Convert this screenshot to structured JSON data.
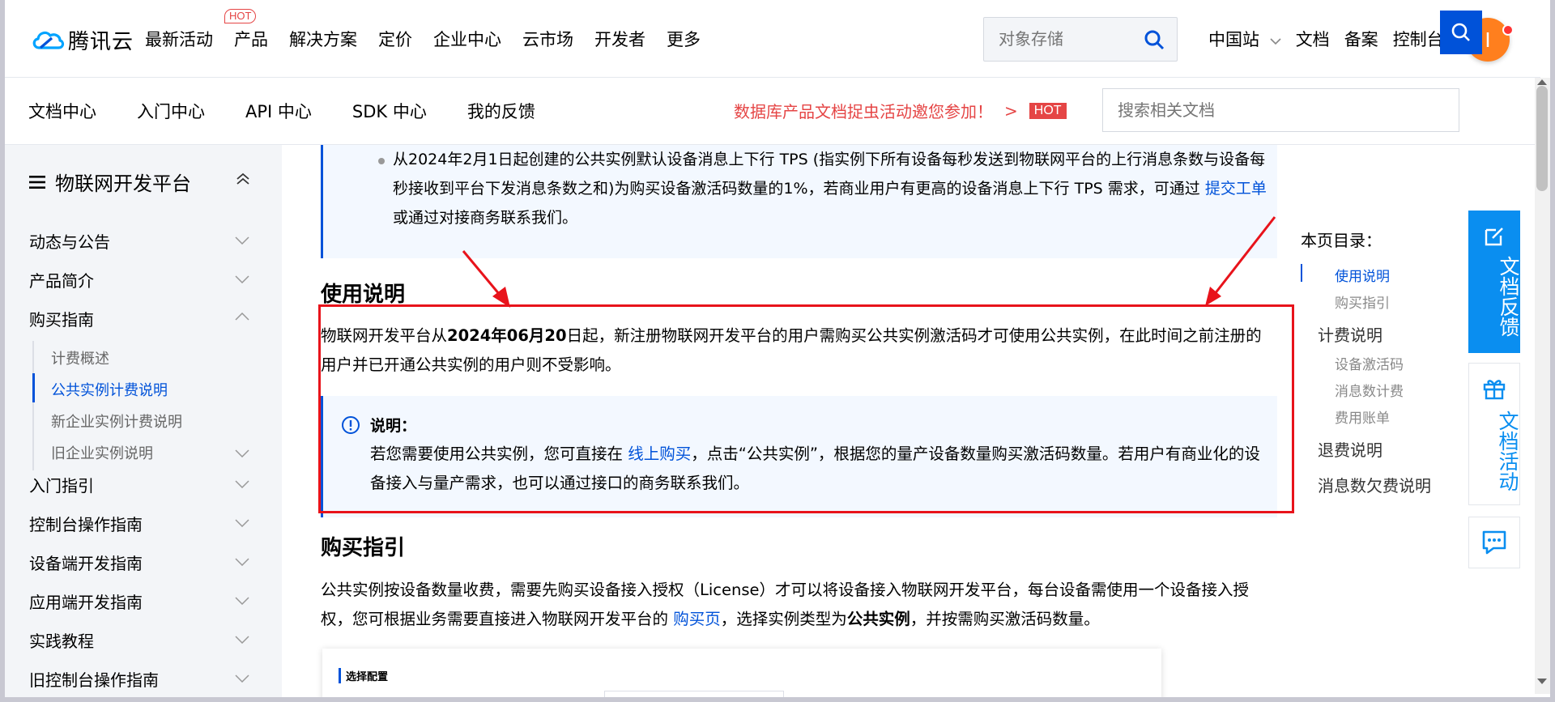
{
  "topnav": {
    "logo_text": "腾讯云",
    "items": [
      "最新活动",
      "产品",
      "解决方案",
      "定价",
      "企业中心",
      "云市场",
      "开发者",
      "更多"
    ],
    "hot_badge": "HOT",
    "search_placeholder": "对象存储",
    "right_links": [
      "中国站",
      "文档",
      "备案",
      "控制台"
    ],
    "avatar_initial": "I"
  },
  "subnav": {
    "items": [
      "文档中心",
      "入门中心",
      "API 中心",
      "SDK 中心",
      "我的反馈"
    ],
    "promo_text": "数据库产品文档捉虫活动邀您参加！",
    "promo_arrow": ">",
    "promo_hot": "HOT",
    "doc_search_placeholder": "搜索相关文档"
  },
  "sidebar": {
    "title": "物联网开发平台",
    "items": [
      {
        "label": "动态与公告"
      },
      {
        "label": "产品简介"
      },
      {
        "label": "购买指南"
      },
      {
        "label": "入门指引"
      },
      {
        "label": "控制台操作指南"
      },
      {
        "label": "设备端开发指南"
      },
      {
        "label": "应用端开发指南"
      },
      {
        "label": "实践教程"
      },
      {
        "label": "旧控制台操作指南"
      }
    ],
    "sub_items": [
      {
        "label": "计费概述"
      },
      {
        "label": "公共实例计费说明"
      },
      {
        "label": "新企业实例计费说明"
      },
      {
        "label": "旧企业实例说明"
      }
    ]
  },
  "main": {
    "notice_top": {
      "text_before_link": "从2024年2月1日起创建的公共实例默认设备消息上下行 TPS (指实例下所有设备每秒发送到物联网平台的上行消息条数与设备每秒接收到平台下发消息条数之和)为购买设备激活码数量的1%，若商业用户有更高的设备消息上下行 TPS 需求，可通过 ",
      "link": "提交工单",
      "text_after_link": " 或通过对接商务联系我们。"
    },
    "usage_heading": "使用说明",
    "usage_para_1": "物联网开发平台从",
    "usage_para_bold": "2024年06月20",
    "usage_para_2": "日起，新注册物联网开发平台的用户需购买公共实例激活码才可使用公共实例，在此时间之前注册的用户并已开通公共实例的用户则不受影响。",
    "note": {
      "title": "说明：",
      "text_before_link": "若您需要使用公共实例，您可直接在 ",
      "link": "线上购买",
      "text_after_link": "，点击“公共实例”，根据您的量产设备数量购买激活码数量。若用户有商业化的设备接入与量产需求，也可以通过接口的商务联系我们。"
    },
    "purchase_heading": "购买指引",
    "purchase_para_1": "公共实例按设备数量收费，需要先购买设备接入授权（License）才可以将设备接入物联网开发平台，每台设备需使用一个设备接入授权，您可根据业务需要直接进入物联网开发平台的 ",
    "purchase_link": "购买页",
    "purchase_para_2": "，选择实例类型为",
    "purchase_bold": "公共实例",
    "purchase_para_3": "，并按需购买激活码数量。",
    "config_label": "选择配置"
  },
  "toc": {
    "title": "本页目录：",
    "items": [
      {
        "label": "使用说明",
        "level": 2,
        "active": true
      },
      {
        "label": "购买指引",
        "level": 2
      },
      {
        "label": "计费说明",
        "level": 1
      },
      {
        "label": "设备激活码",
        "level": 2
      },
      {
        "label": "消息数计费",
        "level": 2
      },
      {
        "label": "费用账单",
        "level": 2
      },
      {
        "label": "退费说明",
        "level": 1
      },
      {
        "label": "消息数欠费说明",
        "level": 1
      }
    ]
  },
  "float_buttons": {
    "feedback": "文档反馈",
    "activity": "文档活动"
  },
  "colors": {
    "brand_blue": "#0052d9",
    "link_blue": "#0052d9",
    "hot_red": "#e54545",
    "annotation_red": "#e8131b",
    "float_blue": "#0a8ef0",
    "avatar_orange": "#ff7f1e"
  }
}
